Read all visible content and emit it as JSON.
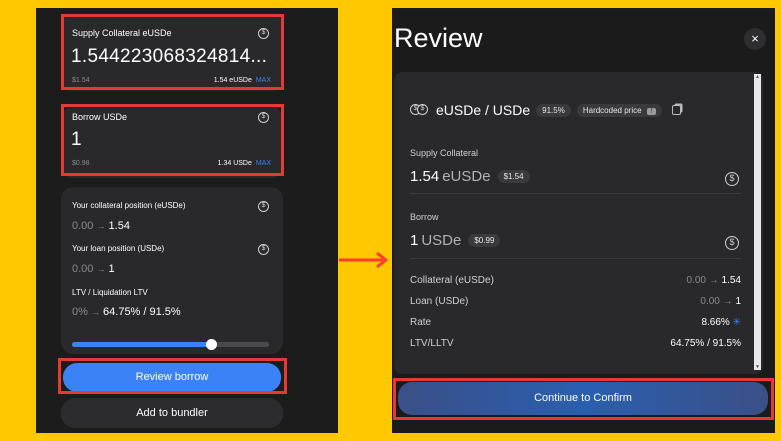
{
  "left": {
    "supply": {
      "title": "Supply Collateral eUSDe",
      "amount": "1.544223068324814...",
      "usd": "$1.54",
      "balance": "1.54 eUSDe",
      "max": "MAX"
    },
    "borrow": {
      "title": "Borrow USDe",
      "amount": "1",
      "usd": "$0.98",
      "balance": "1.34 USDe",
      "max": "MAX"
    },
    "position": {
      "collateral_label": "Your collateral position (eUSDe)",
      "collateral_from": "0.00",
      "collateral_to": "1.54",
      "loan_label": "Your loan position (USDe)",
      "loan_from": "0.00",
      "loan_to": "1",
      "ltv_label": "LTV / Liquidation LTV",
      "ltv_from": "0%",
      "ltv_to": "64.75% / 91.5%",
      "slider_fraction": 0.7075
    },
    "review_button": "Review borrow",
    "bundler_button": "Add to bundler"
  },
  "arrow_symbol": "→",
  "right": {
    "title": "Review",
    "close": "×",
    "market": {
      "pair": "eUSDe / USDe",
      "lltv": "91.5%",
      "price_badge": "Hardcoded price",
      "badge_icon": "!"
    },
    "supply_label": "Supply Collateral",
    "supply_amount": "1.54",
    "supply_token": "eUSDe",
    "supply_usd": "$1.54",
    "borrow_label": "Borrow",
    "borrow_amount": "1",
    "borrow_token": "USDe",
    "borrow_usd": "$0.99",
    "summary": [
      {
        "label": "Collateral (eUSDe)",
        "from": "0.00",
        "to": "1.54"
      },
      {
        "label": "Loan (USDe)",
        "from": "0.00",
        "to": "1"
      },
      {
        "label": "Rate",
        "value": "8.66%"
      },
      {
        "label": "LTV/LLTV",
        "value": "64.75% / 91.5%"
      }
    ],
    "confirm_button": "Continue to Confirm"
  },
  "colors": {
    "background": "#FFC800",
    "highlight": "#e53935",
    "accent": "#3b82f6",
    "arrow": "#ff3b2f"
  }
}
